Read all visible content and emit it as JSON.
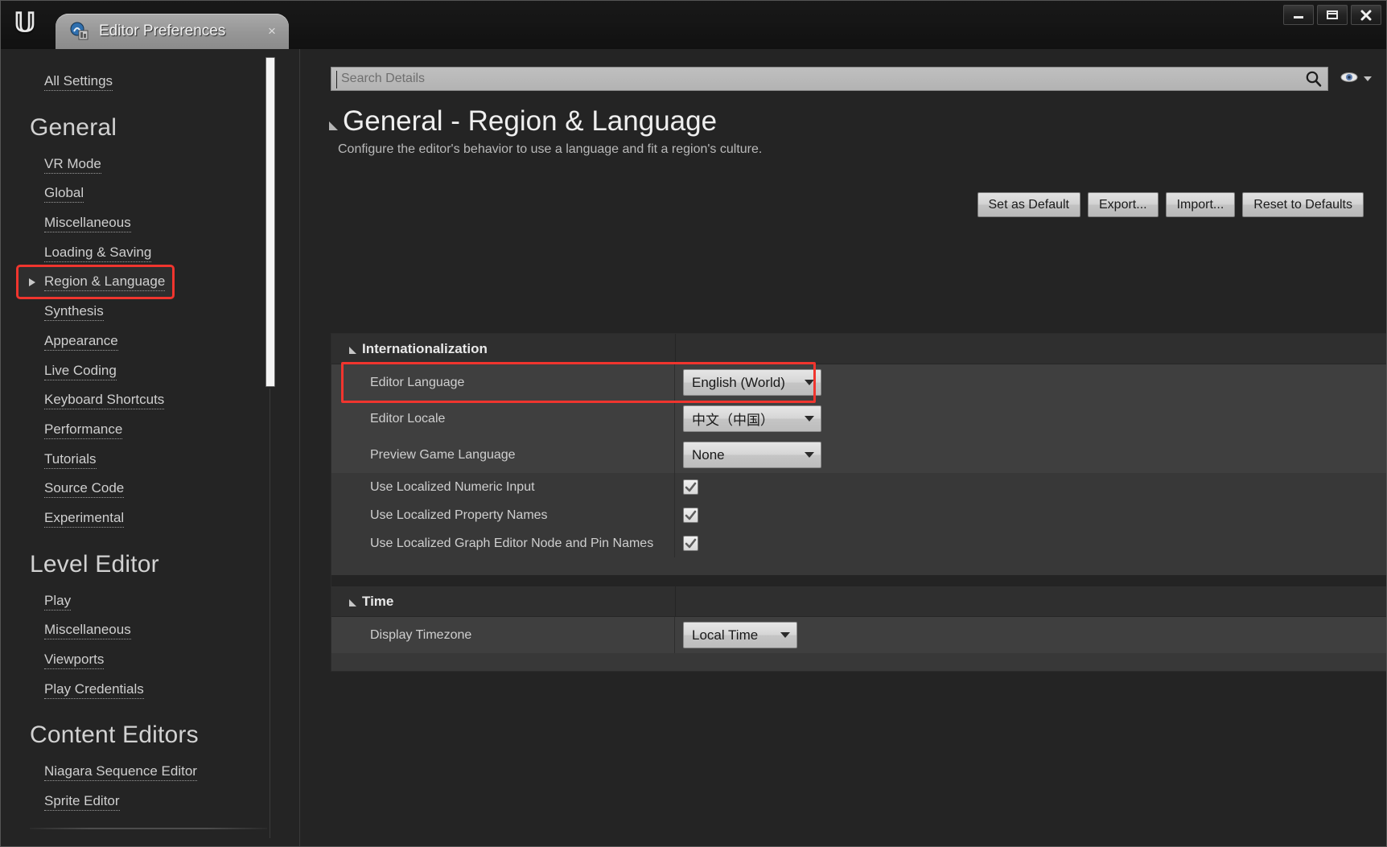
{
  "window": {
    "app_logo": "unreal-engine-logo",
    "tab": {
      "title": "Editor Preferences",
      "icon": "editor-preferences-icon",
      "close_label": "×"
    },
    "controls": {
      "minimize": "minimize-icon",
      "maximize": "maximize-icon",
      "close": "close-icon"
    }
  },
  "sidebar": {
    "top_items": [
      {
        "label": "All Settings",
        "selected": false
      }
    ],
    "groups": [
      {
        "title": "General",
        "items": [
          {
            "label": "VR Mode",
            "selected": false
          },
          {
            "label": "Global",
            "selected": false
          },
          {
            "label": "Miscellaneous",
            "selected": false
          },
          {
            "label": "Loading & Saving",
            "selected": false
          },
          {
            "label": "Region & Language",
            "selected": true
          },
          {
            "label": "Synthesis",
            "selected": false
          },
          {
            "label": "Appearance",
            "selected": false
          },
          {
            "label": "Live Coding",
            "selected": false
          },
          {
            "label": "Keyboard Shortcuts",
            "selected": false
          },
          {
            "label": "Performance",
            "selected": false
          },
          {
            "label": "Tutorials",
            "selected": false
          },
          {
            "label": "Source Code",
            "selected": false
          },
          {
            "label": "Experimental",
            "selected": false
          }
        ]
      },
      {
        "title": "Level Editor",
        "items": [
          {
            "label": "Play",
            "selected": false
          },
          {
            "label": "Miscellaneous",
            "selected": false
          },
          {
            "label": "Viewports",
            "selected": false
          },
          {
            "label": "Play Credentials",
            "selected": false
          }
        ]
      },
      {
        "title": "Content Editors",
        "items": [
          {
            "label": "Niagara Sequence Editor",
            "selected": false
          },
          {
            "label": "Sprite Editor",
            "selected": false
          }
        ]
      }
    ]
  },
  "main": {
    "search": {
      "placeholder": "Search Details",
      "value": "",
      "magnifier_icon": "search-icon",
      "view_options_icon": "eye-icon",
      "view_options_caret": "chevron-down-icon"
    },
    "page_title": "General - Region & Language",
    "page_subtitle": "Configure the editor's behavior to use a language and fit a region's culture.",
    "action_buttons": [
      {
        "label": "Set as Default",
        "name": "set-as-default-button"
      },
      {
        "label": "Export...",
        "name": "export-button"
      },
      {
        "label": "Import...",
        "name": "import-button"
      },
      {
        "label": "Reset to Defaults",
        "name": "reset-to-defaults-button"
      }
    ],
    "categories": [
      {
        "name": "Internationalization",
        "rows": [
          {
            "label": "Editor Language",
            "type": "combo",
            "value": "English (World)",
            "highlighted": true
          },
          {
            "label": "Editor Locale",
            "type": "combo",
            "value": "中文（中国）",
            "highlighted": false
          },
          {
            "label": "Preview Game Language",
            "type": "combo",
            "value": "None",
            "highlighted": false
          },
          {
            "label": "Use Localized Numeric Input",
            "type": "checkbox",
            "checked": true
          },
          {
            "label": "Use Localized Property Names",
            "type": "checkbox",
            "checked": true
          },
          {
            "label": "Use Localized Graph Editor Node and Pin Names",
            "type": "checkbox",
            "checked": true
          }
        ]
      },
      {
        "name": "Time",
        "rows": [
          {
            "label": "Display Timezone",
            "type": "combo",
            "value": "Local Time",
            "highlighted": false
          }
        ]
      }
    ]
  },
  "colors": {
    "highlight_red": "#f0352e",
    "panel_bg": "#383838",
    "row_alt_bg": "#3f3f3f",
    "app_bg": "#242424"
  }
}
